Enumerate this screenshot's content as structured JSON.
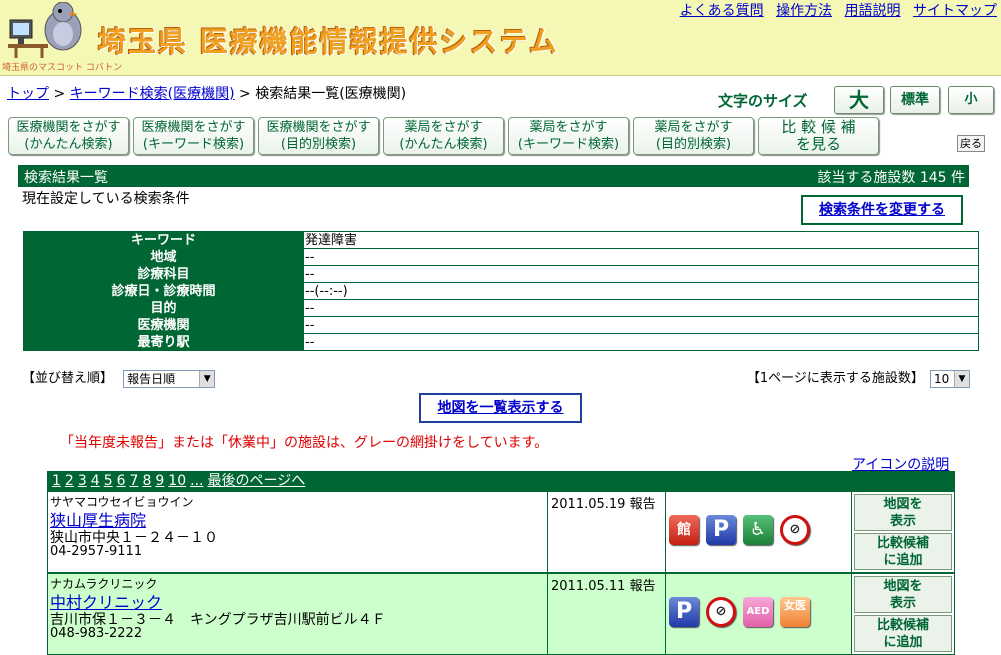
{
  "header": {
    "site_title": "埼玉県 医療機能情報提供システム",
    "mascot_caption": "埼玉県のマスコット コバトン",
    "top_links": [
      "よくある質問",
      "操作方法",
      "用語説明",
      "サイトマップ"
    ]
  },
  "breadcrumb": {
    "home": "トップ",
    "keyword": "キーワード検索(医療機関)",
    "current": "検索結果一覧(医療機関)",
    "sep": ">"
  },
  "fontsize": {
    "label": "文字のサイズ",
    "large": "大",
    "normal": "標準",
    "small": "小"
  },
  "nav": {
    "b1": [
      "医療機関をさがす",
      "(かんたん検索)"
    ],
    "b2": [
      "医療機関をさがす",
      "(キーワード検索)"
    ],
    "b3": [
      "医療機関をさがす",
      "(目的別検索)"
    ],
    "b4": [
      "薬局をさがす",
      "(かんたん検索)"
    ],
    "b5": [
      "薬局をさがす",
      "(キーワード検索)"
    ],
    "b6": [
      "薬局をさがす",
      "(目的別検索)"
    ],
    "b7": [
      "比 較 候 補",
      "を見る"
    ],
    "back": "戻る"
  },
  "results": {
    "title": "検索結果一覧",
    "count": "該当する施設数 145 件",
    "current_conditions": "現在設定している検索条件",
    "change_conditions": "検索条件を変更する"
  },
  "conditions": [
    {
      "key": "キーワード",
      "value": "発達障害"
    },
    {
      "key": "地域",
      "value": "--"
    },
    {
      "key": "診療科目",
      "value": "--"
    },
    {
      "key": "診療日・診療時間",
      "value": "--(--:--)"
    },
    {
      "key": "目的",
      "value": "--"
    },
    {
      "key": "医療機関",
      "value": "--"
    },
    {
      "key": "最寄り駅",
      "value": "--"
    }
  ],
  "sort": {
    "label": "【並び替え順】",
    "selected": "報告日順"
  },
  "perpage": {
    "label": "【1ページに表示する施設数】",
    "selected": "10"
  },
  "map_all": "地図を一覧表示する",
  "notice": "「当年度未報告」または「休業中」の施設は、グレーの網掛けをしています。",
  "icon_legend": "アイコンの説明",
  "pager": {
    "pages": [
      "1",
      "2",
      "3",
      "4",
      "5",
      "6",
      "7",
      "8",
      "9",
      "10",
      "..."
    ],
    "last": "最後のページへ"
  },
  "facilities": [
    {
      "kana": "サヤマコウセイビョウイン",
      "name": "狭山厚生病院",
      "address": "狭山市中央１－２４－１０",
      "tel": "04-2957-9111",
      "date": "2011.05.19 報告",
      "icons": [
        "gymnasium-icon",
        "parking-icon",
        "wheelchair-icon",
        "no-smoking-icon"
      ],
      "map_btn": [
        "地図を",
        "表示"
      ],
      "compare_btn": [
        "比較候補",
        "に追加"
      ]
    },
    {
      "kana": "ナカムラクリニック",
      "name": "中村クリニック",
      "address": "吉川市保１－３－４　キングプラザ吉川駅前ビル４Ｆ",
      "tel": "048-983-2222",
      "date": "2011.05.11 報告",
      "icons": [
        "parking-icon",
        "no-smoking-icon",
        "aed-icon",
        "female-doctor-icon"
      ],
      "map_btn": [
        "地図を",
        "表示"
      ],
      "compare_btn": [
        "比較候補",
        "に追加"
      ]
    }
  ],
  "icon_text": {
    "kan": "館",
    "p": "P",
    "wheel": "♿",
    "nosmoke": "🚭",
    "aed": "AED",
    "female": "女医"
  }
}
